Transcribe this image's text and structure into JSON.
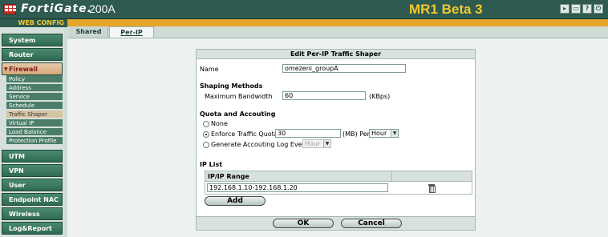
{
  "header": {
    "brand": "FortiGate.",
    "model": "200A",
    "release": "MR1 Beta 3",
    "web_config": "WEB CONFIG",
    "icons": [
      "console-icon",
      "screen-icon",
      "help-icon",
      "logout-icon"
    ]
  },
  "sidebar": {
    "main": [
      {
        "label": "System"
      },
      {
        "label": "Router"
      },
      {
        "label": "Firewall"
      },
      {
        "label": "UTM"
      },
      {
        "label": "VPN"
      },
      {
        "label": "User"
      },
      {
        "label": "Endpoint NAC"
      },
      {
        "label": "Wireless Controller"
      },
      {
        "label": "Log&Report"
      }
    ],
    "sub": [
      {
        "label": "Policy"
      },
      {
        "label": "Address"
      },
      {
        "label": "Service"
      },
      {
        "label": "Schedule"
      },
      {
        "label": "Traffic Shaper"
      },
      {
        "label": "Virtual IP"
      },
      {
        "label": "Load Balance"
      },
      {
        "label": "Protection Profile"
      }
    ],
    "active_main": "Firewall",
    "active_sub": "Traffic Shaper"
  },
  "tabs": [
    {
      "label": "Shared"
    },
    {
      "label": "Per-IP"
    }
  ],
  "form": {
    "title": "Edit Per-IP Traffic Shaper",
    "name_label": "Name",
    "name_value": "omezeni_groupA",
    "shaping_heading": "Shaping Methods",
    "max_bw_label": "Maximum Bandwidth",
    "max_bw_value": "60",
    "max_bw_unit": "(KBps)",
    "quota_heading": "Quota and Accouting",
    "opt_none": "None",
    "opt_enforce": "Enforce Traffic Quota",
    "quota_value": "30",
    "quota_unit": "(MB) Per",
    "quota_period": "Hour",
    "opt_log": "Generate Accouting Log Every",
    "log_period": "Hour",
    "selected_option": "enforce",
    "ip_list_heading": "IP List",
    "ip_col_header": "IP/IP Range",
    "ip_rows": [
      {
        "range": "192.168.1.10-192.168.1.20"
      }
    ],
    "add_label": "Add",
    "ok_label": "OK",
    "cancel_label": "Cancel"
  }
}
